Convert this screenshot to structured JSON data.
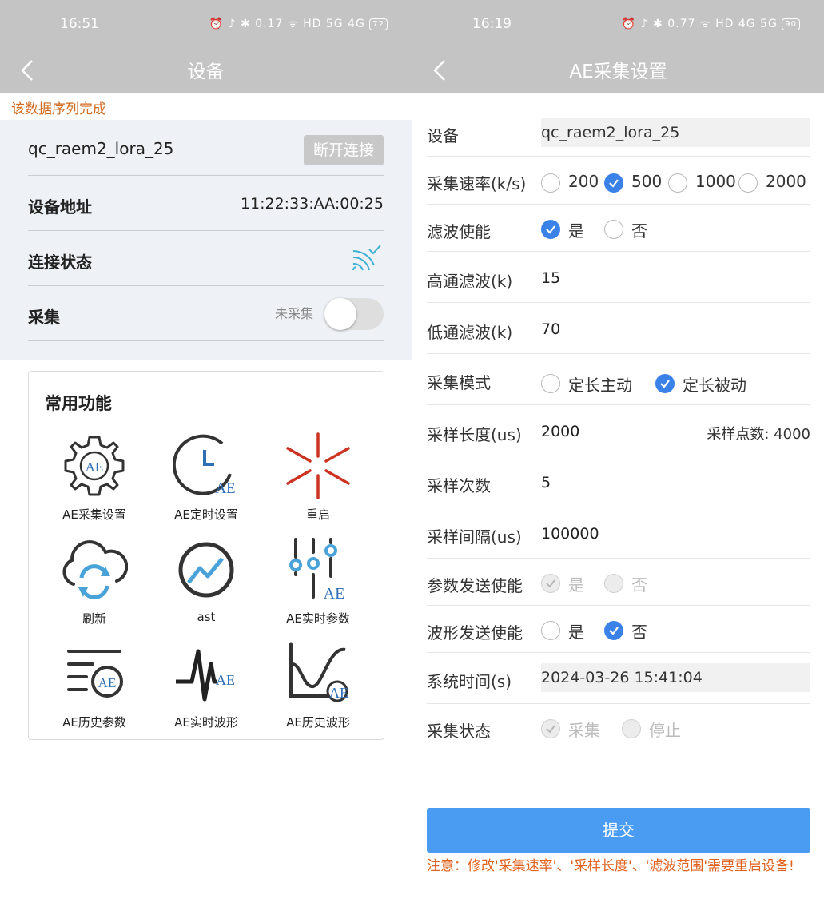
{
  "left": {
    "status": {
      "time": "16:51",
      "icons": "⏰ ♪ ✱ 0.17 ᯤ HD 5G 4G",
      "battery": "72"
    },
    "title": "设备",
    "notice": "该数据序列完成",
    "device_name": "qc_raem2_lora_25",
    "disconnect_label": "断开连接",
    "address_label": "设备地址",
    "address_value": "11:22:33:AA:00:25",
    "connection_label": "连接状态",
    "collect_label": "采集",
    "collect_state": "未采集",
    "functions_title": "常用功能",
    "functions": [
      {
        "label": "AE采集设置",
        "icon": "gear-ae-icon"
      },
      {
        "label": "AE定时设置",
        "icon": "clock-ae-icon"
      },
      {
        "label": "重启",
        "icon": "burst-icon"
      },
      {
        "label": "刷新",
        "icon": "cloud-refresh-icon"
      },
      {
        "label": "ast",
        "icon": "trend-circle-icon"
      },
      {
        "label": "AE实时参数",
        "icon": "sliders-ae-icon"
      },
      {
        "label": "AE历史参数",
        "icon": "list-ae-icon"
      },
      {
        "label": "AE实时波形",
        "icon": "wave-ae-icon"
      },
      {
        "label": "AE历史波形",
        "icon": "curve-ae-icon"
      }
    ],
    "icon_text": "AE"
  },
  "right": {
    "status": {
      "time": "16:19",
      "icons": "⏰ ♪ ✱ 0.77 ᯤ HD 4G 5G",
      "battery": "90"
    },
    "title": "AE采集设置",
    "device_label": "设备",
    "device_value": "qc_raem2_lora_25",
    "rate_label": "采集速率(k/s)",
    "rate_options": [
      "200",
      "500",
      "1000",
      "2000"
    ],
    "filter_label": "滤波使能",
    "yes": "是",
    "no": "否",
    "highpass_label": "高通滤波(k)",
    "highpass_value": "15",
    "lowpass_label": "低通滤波(k)",
    "lowpass_value": "70",
    "mode_label": "采集模式",
    "mode_options": [
      "定长主动",
      "定长被动"
    ],
    "length_label": "采样长度(us)",
    "length_value": "2000",
    "points_text": "采样点数: 4000",
    "count_label": "采样次数",
    "count_value": "5",
    "interval_label": "采样间隔(us)",
    "interval_value": "100000",
    "param_send_label": "参数发送使能",
    "wave_send_label": "波形发送使能",
    "systime_label": "系统时间(s)",
    "systime_value": "2024-03-26 15:41:04",
    "state_label": "采集状态",
    "state_options": [
      "采集",
      "停止"
    ],
    "submit_label": "提交",
    "note": "注意：修改'采集速率'、'采样长度'、'滤波范围'需要重启设备!"
  },
  "colors": {
    "accent": "#3b82e8",
    "button": "#4a9cf2",
    "warning": "#e0621f",
    "bar": "#c4c4c4"
  }
}
